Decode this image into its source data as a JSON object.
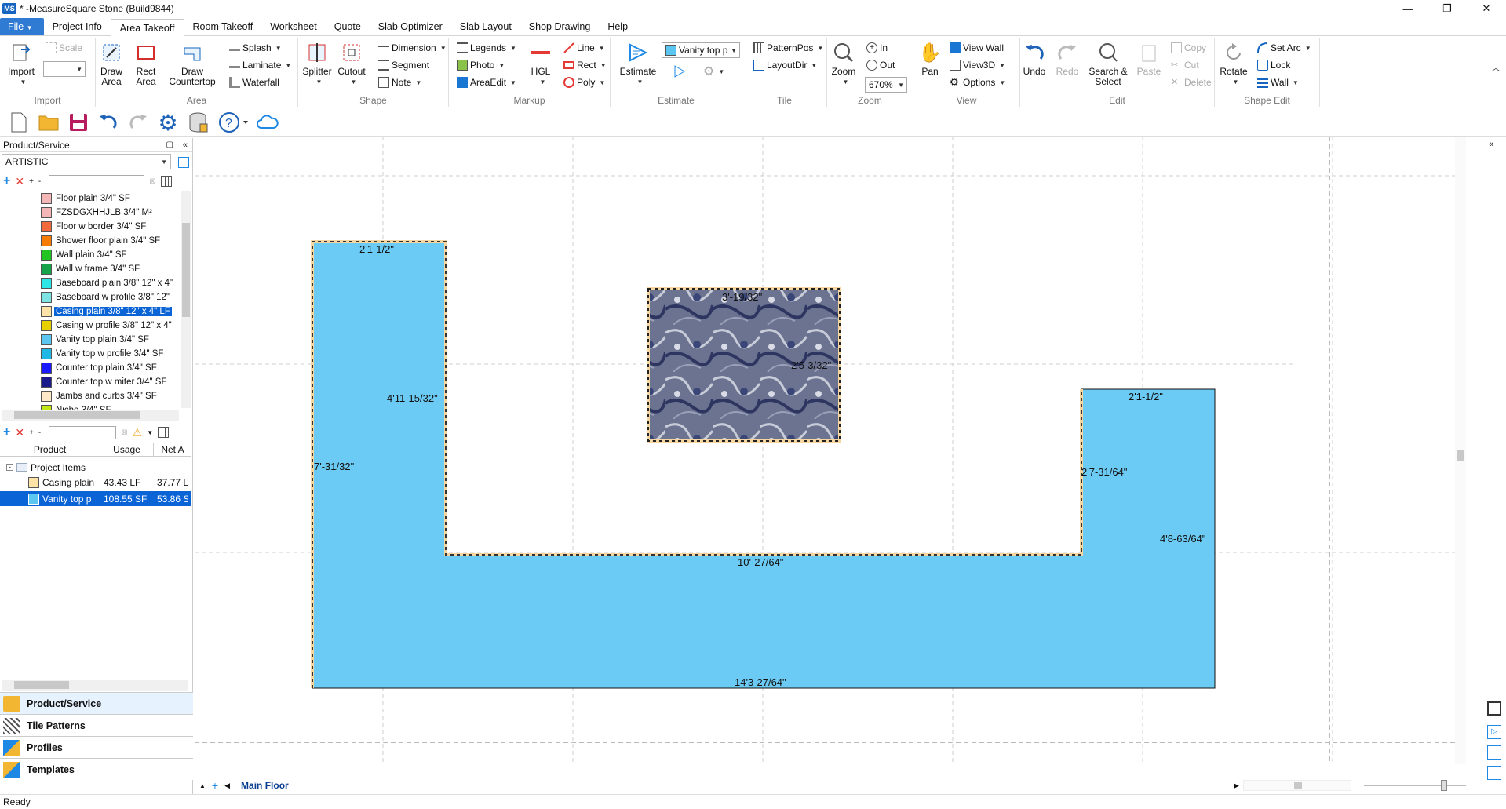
{
  "window": {
    "title": "* -MeasureSquare Stone (Build9844)",
    "logo": "MS",
    "minimize": "—",
    "restore": "❐",
    "close": "✕"
  },
  "menu_tabs": [
    "File",
    "Project Info",
    "Area Takeoff",
    "Room Takeoff",
    "Worksheet",
    "Quote",
    "Slab Optimizer",
    "Slab Layout",
    "Shop Drawing",
    "Help"
  ],
  "active_tab": "Area Takeoff",
  "ribbon": {
    "import": {
      "label": "Import",
      "scale": "Scale",
      "group": "Import"
    },
    "area": {
      "draw_area": "Draw Area",
      "rect_area": "Rect Area",
      "draw_countertop": "Draw Countertop",
      "splash": "Splash",
      "laminate": "Laminate",
      "waterfall": "Waterfall",
      "group": "Area"
    },
    "shape": {
      "splitter": "Splitter",
      "cutout": "Cutout",
      "dimension": "Dimension",
      "segment": "Segment",
      "note": "Note",
      "group": "Shape"
    },
    "markup": {
      "legends": "Legends",
      "photo": "Photo",
      "areaedit": "AreaEdit",
      "hgl": "HGL",
      "line": "Line",
      "rect": "Rect",
      "poly": "Poly",
      "group": "Markup"
    },
    "estimate": {
      "estimate": "Estimate",
      "product_select": "Vanity top p",
      "group": "Estimate"
    },
    "tile": {
      "patternpos": "PatternPos",
      "layoutdir": "LayoutDir",
      "group": "Tile"
    },
    "zoom": {
      "zoom": "Zoom",
      "in": "In",
      "out": "Out",
      "level": "670%",
      "group": "Zoom"
    },
    "view": {
      "pan": "Pan",
      "view_wall": "View Wall",
      "view3d": "View3D",
      "options": "Options",
      "group": "View"
    },
    "edit": {
      "undo": "Undo",
      "redo": "Redo",
      "search_select": "Search & Select",
      "paste": "Paste",
      "copy": "Copy",
      "cut": "Cut",
      "delete": "Delete",
      "group": "Edit"
    },
    "shape_edit": {
      "rotate": "Rotate",
      "set_arc": "Set Arc",
      "lock": "Lock",
      "wall": "Wall",
      "group": "Shape Edit"
    }
  },
  "left_panel": {
    "header": "Product/Service",
    "category": "ARTISTIC",
    "products": [
      {
        "label": "Floor plain  3/4\" SF",
        "color": "#f4b6b6"
      },
      {
        "label": "FZSDGXHHJLB  3/4\" M²",
        "color": "#f4b6b6"
      },
      {
        "label": "Floor w border  3/4\" SF",
        "color": "#f26a3b"
      },
      {
        "label": "Shower floor plain  3/4\" SF",
        "color": "#f57c00"
      },
      {
        "label": "Wall plain  3/4\" SF",
        "color": "#22c422"
      },
      {
        "label": "Wall w frame  3/4\" SF",
        "color": "#16a34a"
      },
      {
        "label": "Baseboard plain  3/8\" 12\" x 4\"",
        "color": "#2ee6e6"
      },
      {
        "label": "Baseboard w profile  3/8\" 12\"",
        "color": "#7de3e3"
      },
      {
        "label": "Casing plain  3/8\" 12\" x 4\" LF",
        "color": "#fde3a7"
      },
      {
        "label": "Casing w profile  3/8\" 12\" x 4\"",
        "color": "#e6d000"
      },
      {
        "label": "Vanity top plain  3/4\" SF",
        "color": "#5bc6f0"
      },
      {
        "label": "Vanity top w profile  3/4\" SF",
        "color": "#22b8e6"
      },
      {
        "label": "Counter top plain  3/4\" SF",
        "color": "#1a1aff"
      },
      {
        "label": "Counter top w miter  3/4\" SF",
        "color": "#1a1a8a"
      },
      {
        "label": "Jambs and curbs  3/4\" SF",
        "color": "#fde9c8"
      },
      {
        "label": "Niche  3/4\" SF",
        "color": "#c0e614"
      }
    ],
    "selected_product": 8,
    "table": {
      "headers": [
        "Product",
        "Usage",
        "Net A"
      ],
      "group": "Project Items",
      "rows": [
        {
          "product": "Casing plain",
          "usage": "43.43 LF",
          "net": "37.77 L",
          "color": "#fde3a7"
        },
        {
          "product": "Vanity top p",
          "usage": "108.55 SF",
          "net": "53.86 S",
          "color": "#5bc6f0"
        }
      ]
    },
    "nav": [
      "Product/Service",
      "Tile Patterns",
      "Profiles",
      "Templates"
    ]
  },
  "canvas": {
    "dimensions": {
      "d1": "2'1-1/2\"",
      "d2": "4'11-15/32\"",
      "d3": "7'-31/32\"",
      "d4": "10'-27/64\"",
      "d5": "14'3-27/64\"",
      "d6": "2'1-1/2\"",
      "d7": "2'7-31/64\"",
      "d8": "4'8-63/64\"",
      "d9": "3'-19/32\"",
      "d10": "2'5-3/32\""
    },
    "fill_color": "#6ccbf4",
    "edge_color": "#f5d6a0"
  },
  "floor_tab": "Main Floor",
  "status": "Ready"
}
